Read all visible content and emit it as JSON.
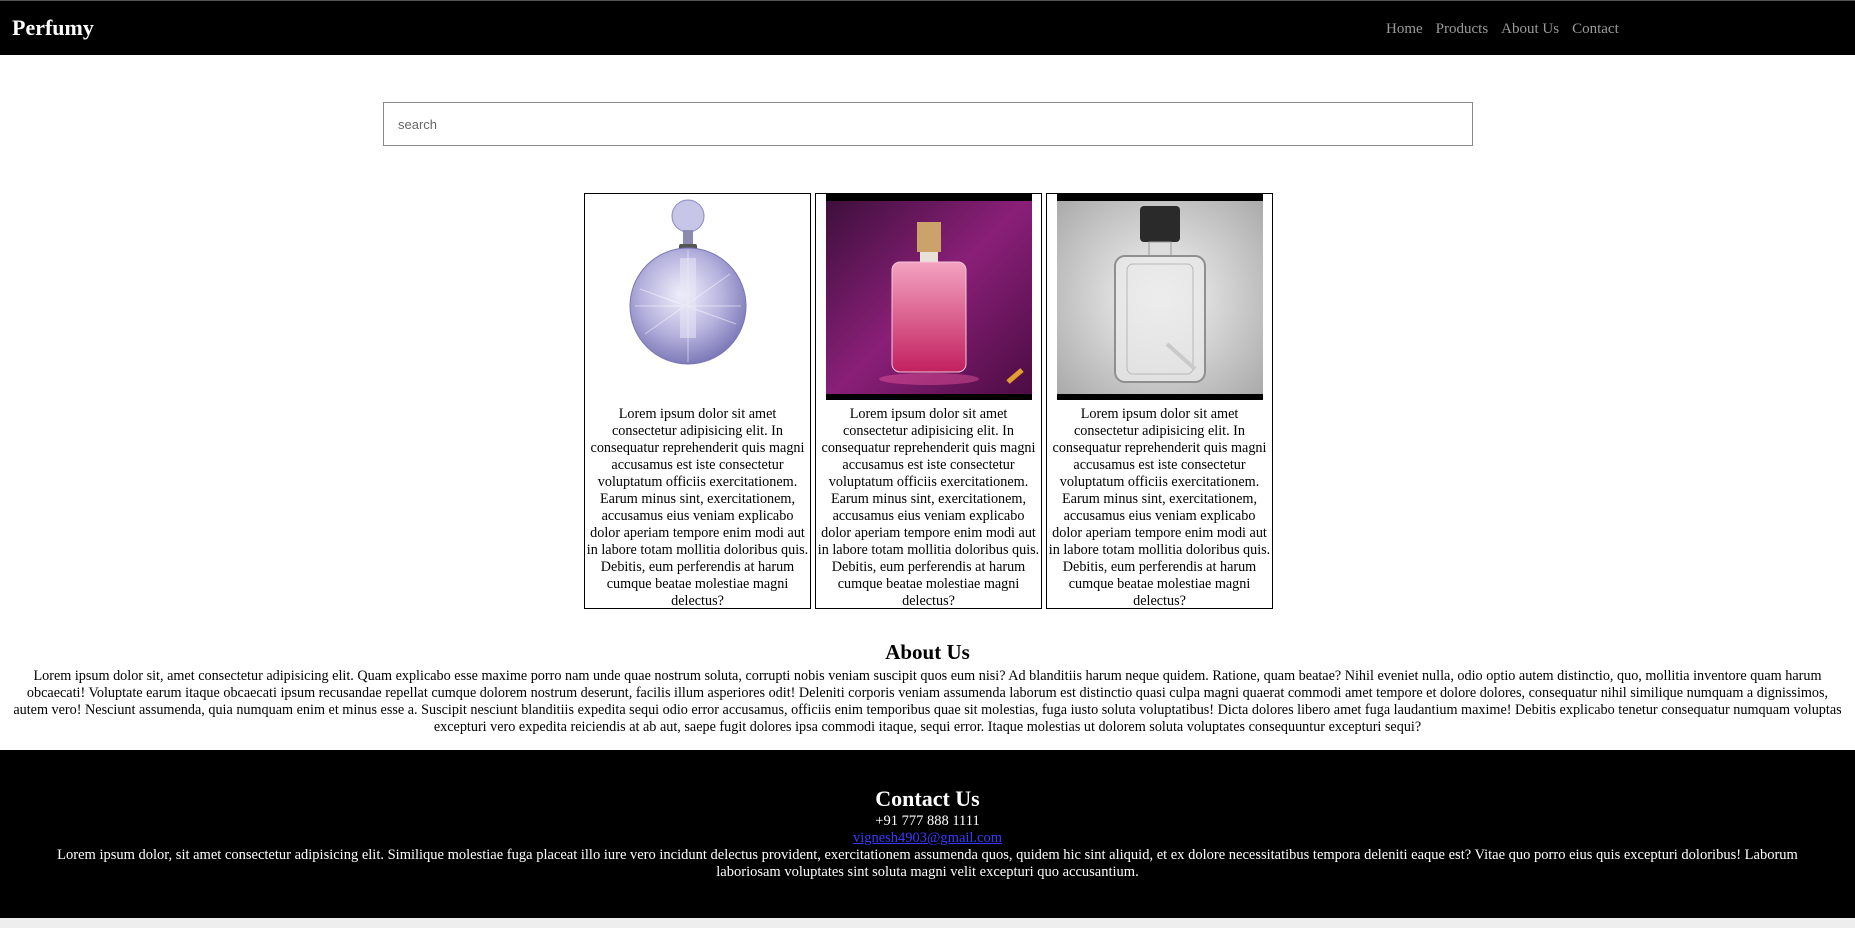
{
  "header": {
    "brand": "Perfumy",
    "nav": [
      "Home",
      "Products",
      "About Us",
      "Contact"
    ]
  },
  "search": {
    "placeholder": "search",
    "value": ""
  },
  "products": [
    {
      "description": "Lorem ipsum dolor sit amet consectetur adipisicing elit. In consequatur reprehenderit quis magni accusamus est iste consectetur voluptatum officiis exercitationem. Earum minus sint, exercitationem, accusamus eius veniam explicabo dolor aperiam tempore enim modi aut in labore totam mollitia doloribus quis. Debitis, eum perferendis at harum cumque beatae molestiae magni delectus?"
    },
    {
      "description": "Lorem ipsum dolor sit amet consectetur adipisicing elit. In consequatur reprehenderit quis magni accusamus est iste consectetur voluptatum officiis exercitationem. Earum minus sint, exercitationem, accusamus eius veniam explicabo dolor aperiam tempore enim modi aut in labore totam mollitia doloribus quis. Debitis, eum perferendis at harum cumque beatae molestiae magni delectus?"
    },
    {
      "description": "Lorem ipsum dolor sit amet consectetur adipisicing elit. In consequatur reprehenderit quis magni accusamus est iste consectetur voluptatum officiis exercitationem. Earum minus sint, exercitationem, accusamus eius veniam explicabo dolor aperiam tempore enim modi aut in labore totam mollitia doloribus quis. Debitis, eum perferendis at harum cumque beatae molestiae magni delectus?"
    }
  ],
  "about": {
    "title": "About Us",
    "text": "Lorem ipsum dolor sit, amet consectetur adipisicing elit. Quam explicabo esse maxime porro nam unde quae nostrum soluta, corrupti nobis veniam suscipit quos eum nisi? Ad blanditiis harum neque quidem. Ratione, quam beatae? Nihil eveniet nulla, odio optio autem distinctio, quo, mollitia inventore quam harum obcaecati! Voluptate earum itaque obcaecati ipsum recusandae repellat cumque dolorem nostrum deserunt, facilis illum asperiores odit! Deleniti corporis veniam assumenda laborum est distinctio quasi culpa magni quaerat commodi amet tempore et dolore dolores, consequatur nihil similique numquam a dignissimos, autem vero! Nesciunt assumenda, quia numquam enim et minus esse a. Suscipit nesciunt blanditiis expedita sequi odio error accusamus, officiis enim temporibus quae sit molestias, fuga iusto soluta voluptatibus! Dicta dolores libero amet fuga laudantium maxime! Debitis explicabo tenetur consequatur numquam voluptas excepturi vero expedita reiciendis at ab aut, saepe fugit dolores ipsa commodi itaque, sequi error. Itaque molestias ut dolorem soluta voluptates consequuntur excepturi sequi?"
  },
  "contact": {
    "title": "Contact Us",
    "phone": "+91 777 888 1111",
    "email": "vignesh4903@gmail.com",
    "text": "Lorem ipsum dolor, sit amet consectetur adipisicing elit. Similique molestiae fuga placeat illo iure vero incidunt delectus provident, exercitationem assumenda quos, quidem hic sint aliquid, et ex dolore necessitatibus tempora deleniti eaque est? Vitae quo porro eius quis excepturi doloribus! Laborum laboriosam voluptates sint soluta magni velit excepturi quo accusantium."
  },
  "colors": {
    "header_bg": "#000000",
    "footer_bg": "#000000",
    "nav_link": "#9a9a9a",
    "email_link": "#3a3aff"
  }
}
